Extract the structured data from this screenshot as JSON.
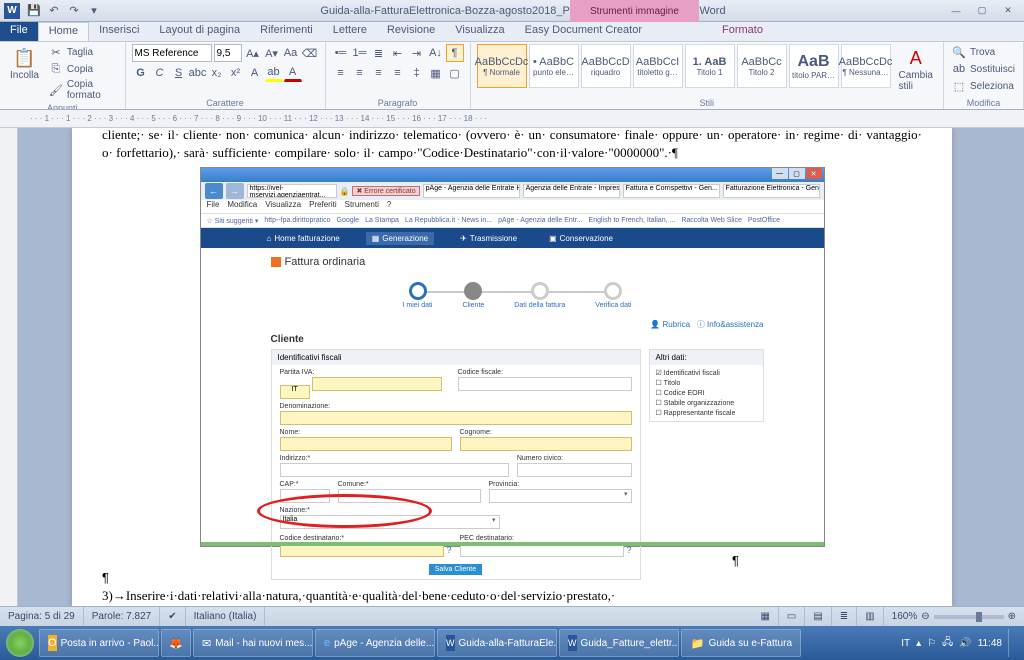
{
  "titlebar": {
    "word_icon": "W",
    "doc_title": "Guida-alla-FatturaElettronica-Bozza-agosto2018_Piancaldini.docx - Microsoft Word",
    "contextual_title": "Strumenti immagine"
  },
  "tabs": {
    "file": "File",
    "home": "Home",
    "inserisci": "Inserisci",
    "layout": "Layout di pagina",
    "riferimenti": "Riferimenti",
    "lettere": "Lettere",
    "revisione": "Revisione",
    "visualizza": "Visualizza",
    "easy": "Easy Document Creator",
    "formato": "Formato"
  },
  "ribbon": {
    "clipboard": {
      "paste": "Incolla",
      "cut": "Taglia",
      "copy": "Copia",
      "formatpaint": "Copia formato",
      "group": "Appunti"
    },
    "font": {
      "name": "MS Reference",
      "size": "9,5",
      "group": "Carattere"
    },
    "para": {
      "group": "Paragrafo"
    },
    "styles": {
      "group": "Stili",
      "s1p": "AaBbCcDc",
      "s1": "¶ Normale",
      "s2p": "• AaBbC",
      "s2": "punto ele…",
      "s3p": "AaBbCcD",
      "s3": "riquadro",
      "s4p": "AaBbCcI",
      "s4": "titoletto g…",
      "s5p": "1. AaB",
      "s5": "Titolo 1",
      "s6p": "AaBbCc",
      "s6": "Titolo 2",
      "s7p": "AaB",
      "s7": "titolo PAR…",
      "s8p": "AaBbCcDc",
      "s8": "¶ Nessuna…",
      "change": "Cambia stili"
    },
    "editing": {
      "find": "Trova",
      "replace": "Sostituisci",
      "select": "Seleziona",
      "group": "Modifica"
    }
  },
  "doc": {
    "p1": "cliente;· se· il· cliente· non· comunica· alcun· indirizzo· telematico· (ovvero· è· un· consumatore· finale· oppure· un· operatore· in· regime· di· vantaggio· o· forfettario),· sarà· sufficiente· compilare· solo· il· campo·\"Codice·Destinatario\"·con·il·valore·\"0000000\".·¶",
    "p2": "¶",
    "p3": "3)→Inserire·i·dati·relativi·alla·natura,·quantità·e·qualità·del·bene·ceduto·o·del·servizio·prestato,·"
  },
  "browser": {
    "url": "https://ivel-mservizi.agenziaentrat...",
    "cert_err": "Errore certificato",
    "tab1": "pAge - Agenzia delle Entrate H...",
    "tab2": "Agenzia delle Entrate - Impres...",
    "tab3": "Fattura e Corrispettivi - Gen...",
    "tab4": "Fatturazione Elettronica - Gen...",
    "menu": {
      "file": "File",
      "modifica": "Modifica",
      "visualizza": "Visualizza",
      "preferiti": "Preferiti",
      "strumenti": "Strumenti",
      "help": "?"
    },
    "fav": {
      "suggest": "Siti suggeriti",
      "f1": "http--fpa.dirittopratico",
      "f2": "Google",
      "f3": "La Stampa",
      "f4": "La Repubblica.it - News in...",
      "f5": "pAge - Agenzia delle Entr...",
      "f6": "English to French, Italian, ...",
      "f7": "Raccolta Web Slice",
      "f8": "PostOffice"
    },
    "nav": {
      "home": "Home fatturazione",
      "gen": "Generazione",
      "trasm": "Trasmissione",
      "cons": "Conservazione"
    },
    "page_title": "Fattura ordinaria",
    "steps": {
      "s1": "I miei dati",
      "s2": "Cliente",
      "s3": "Dati della fattura",
      "s4": "Verifica dati"
    },
    "links": {
      "rubrica": "Rubrica",
      "info": "Info&assistenza"
    },
    "section": "Cliente",
    "form": {
      "head": "Identificativi fiscali",
      "partita": "Partita IVA:",
      "partita_prefix": "IT",
      "cf": "Codice fiscale:",
      "denom": "Denominazione:",
      "nome": "Nome:",
      "cognome": "Cognome:",
      "indirizzo": "Indirizzo:*",
      "civico": "Numero civico:",
      "cap": "CAP:*",
      "comune": "Comune:*",
      "provincia": "Provincia:",
      "nazione": "Nazione:*",
      "nazione_val": "Italia",
      "coddest": "Codice destinatario:*",
      "pec": "PEC destinatario:",
      "salva": "Salva Cliente"
    },
    "side": {
      "head": "Altri dati:",
      "c1": "Identificativi fiscali",
      "c2": "Titolo",
      "c3": "Codice EORI",
      "c4": "Stabile organizzazione",
      "c5": "Rappresentante fiscale"
    }
  },
  "status": {
    "page": "Pagina: 5 di 29",
    "words": "Parole: 7.827",
    "lang": "Italiano (Italia)",
    "zoom": "160%"
  },
  "taskbar": {
    "t1": "Posta in arrivo - Paol...",
    "t2": "Mail - hai nuovi mes...",
    "t3": "pAge - Agenzia delle...",
    "t4": "Guida-alla-FatturaEle...",
    "t5": "Guida_Fatture_elettr...",
    "t6": "Guida su e-Fattura",
    "lang": "IT",
    "time": "11:48"
  }
}
